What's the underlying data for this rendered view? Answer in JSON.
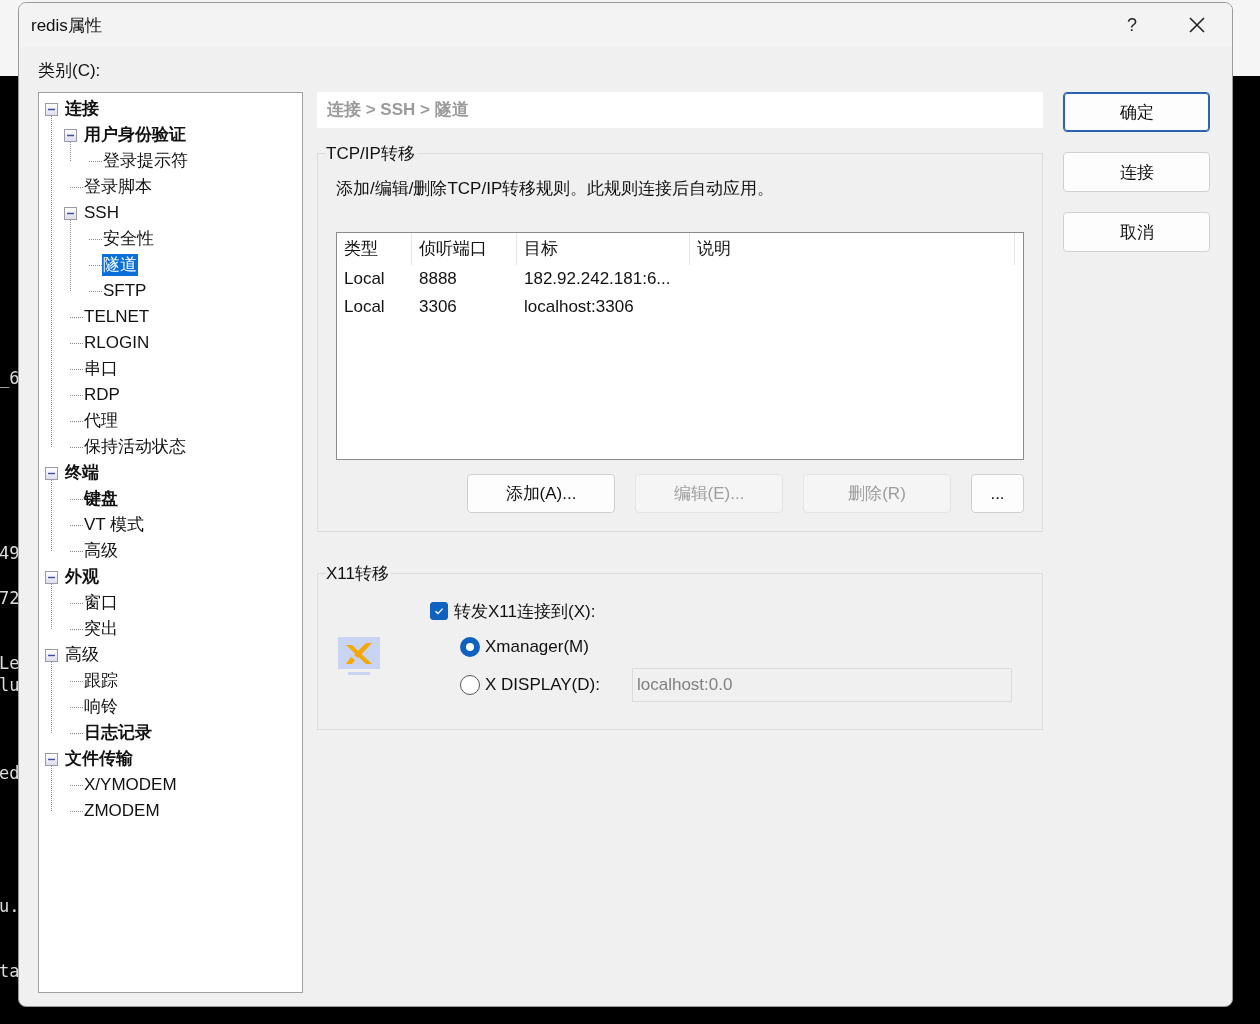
{
  "terminal": {
    "fragments": [
      "_6",
      "49",
      "72",
      "Le",
      "lu",
      "ed",
      "u.",
      "ta"
    ]
  },
  "window": {
    "title": "redis属性",
    "help": "?"
  },
  "category_label": "类别(C):",
  "tree": [
    {
      "label": "连接",
      "bold": true,
      "expanded": true,
      "selected": false,
      "children": [
        {
          "label": "用户身份验证",
          "bold": true,
          "expanded": true,
          "selected": false,
          "children": [
            {
              "label": "登录提示符",
              "bold": false,
              "selected": false
            }
          ]
        },
        {
          "label": "登录脚本",
          "bold": false,
          "selected": false
        },
        {
          "label": "SSH",
          "bold": false,
          "expanded": true,
          "selected": false,
          "children": [
            {
              "label": "安全性",
              "bold": false,
              "selected": false
            },
            {
              "label": "隧道",
              "bold": false,
              "selected": true
            },
            {
              "label": "SFTP",
              "bold": false,
              "selected": false
            }
          ]
        },
        {
          "label": "TELNET",
          "bold": false,
          "selected": false
        },
        {
          "label": "RLOGIN",
          "bold": false,
          "selected": false
        },
        {
          "label": "串口",
          "bold": false,
          "selected": false
        },
        {
          "label": "RDP",
          "bold": false,
          "selected": false
        },
        {
          "label": "代理",
          "bold": false,
          "selected": false
        },
        {
          "label": "保持活动状态",
          "bold": false,
          "selected": false
        }
      ]
    },
    {
      "label": "终端",
      "bold": true,
      "expanded": true,
      "selected": false,
      "children": [
        {
          "label": "键盘",
          "bold": true,
          "selected": false
        },
        {
          "label": "VT 模式",
          "bold": false,
          "selected": false
        },
        {
          "label": "高级",
          "bold": false,
          "selected": false
        }
      ]
    },
    {
      "label": "外观",
      "bold": true,
      "expanded": true,
      "selected": false,
      "children": [
        {
          "label": "窗口",
          "bold": false,
          "selected": false
        },
        {
          "label": "突出",
          "bold": false,
          "selected": false
        }
      ]
    },
    {
      "label": "高级",
      "bold": false,
      "expanded": true,
      "selected": false,
      "children": [
        {
          "label": "跟踪",
          "bold": false,
          "selected": false
        },
        {
          "label": "响铃",
          "bold": false,
          "selected": false
        },
        {
          "label": "日志记录",
          "bold": true,
          "selected": false
        }
      ]
    },
    {
      "label": "文件传输",
      "bold": true,
      "expanded": true,
      "selected": false,
      "children": [
        {
          "label": "X/YMODEM",
          "bold": false,
          "selected": false
        },
        {
          "label": "ZMODEM",
          "bold": false,
          "selected": false
        }
      ]
    }
  ],
  "breadcrumb": "连接 > SSH > 隧道",
  "tcp_group": {
    "title": "TCP/IP转移",
    "description": "添加/编辑/删除TCP/IP转移规则。此规则连接后自动应用。",
    "table": {
      "columns": [
        "类型",
        "侦听端口",
        "目标",
        "说明"
      ],
      "rows": [
        [
          "Local",
          "8888",
          "182.92.242.181:6..."
        ],
        [
          "Local",
          "3306",
          "localhost:3306"
        ]
      ]
    },
    "buttons": [
      {
        "label": "添加(A)...",
        "disabled": false
      },
      {
        "label": "编辑(E)...",
        "disabled": true
      },
      {
        "label": "删除(R)",
        "disabled": true
      },
      {
        "label": "...",
        "disabled": false
      }
    ]
  },
  "x11_group": {
    "title": "X11转移",
    "forward": {
      "label": "转发X11连接到(X):",
      "checked": true
    },
    "options": [
      {
        "label": "Xmanager(M)",
        "selected": true
      },
      {
        "label": "X DISPLAY(D):",
        "selected": false
      }
    ],
    "display_field": {
      "value": "localhost:0.0",
      "disabled": true
    }
  },
  "side_buttons": [
    {
      "label": "确定",
      "default": true
    },
    {
      "label": "连接",
      "default": false
    },
    {
      "label": "取消",
      "default": false
    }
  ]
}
